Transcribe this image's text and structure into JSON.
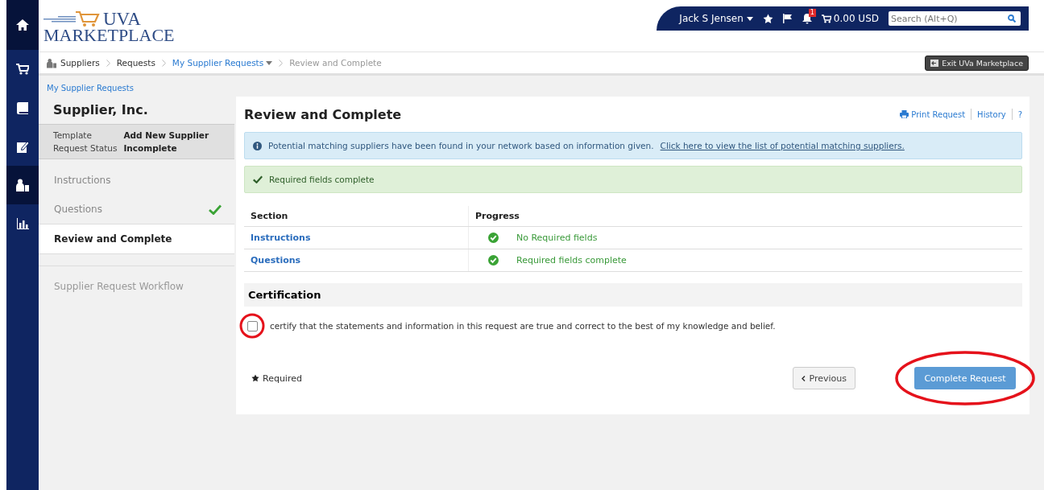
{
  "nav_icons": [
    {
      "kind": "home",
      "selected": true
    },
    {
      "kind": "cart",
      "selected": false
    },
    {
      "kind": "book",
      "selected": false
    },
    {
      "kind": "edit",
      "selected": false
    },
    {
      "kind": "suppliers",
      "selected": true
    },
    {
      "kind": "chart",
      "selected": false
    }
  ],
  "logo": {
    "line1": "UVA",
    "line2": "MARKETPLACE"
  },
  "user_bar": {
    "user": "Jack S Jensen",
    "notifications": "1",
    "cart_total": "0.00 USD",
    "search": {
      "placeholder": "Search (Alt+Q)"
    }
  },
  "breadcrumb": [
    {
      "label": "Suppliers",
      "kind": "root"
    },
    {
      "label": "Requests",
      "kind": "plain"
    },
    {
      "label": "My Supplier Requests",
      "kind": "link"
    },
    {
      "label": "Review and Complete",
      "kind": "current"
    }
  ],
  "exit_button": "Exit UVa Marketplace",
  "sidebar": {
    "back_link": "My Supplier Requests",
    "title": "Supplier, Inc.",
    "meta": [
      {
        "label": "Template",
        "value": "Add New Supplier"
      },
      {
        "label": "Request Status",
        "value": "Incomplete"
      }
    ],
    "steps": [
      {
        "label": "Instructions",
        "selected": false,
        "done": false
      },
      {
        "label": "Questions",
        "selected": false,
        "done": true
      },
      {
        "label": "Review and Complete",
        "selected": true,
        "done": false
      }
    ],
    "workflow": "Supplier Request Workflow"
  },
  "main": {
    "title": "Review and Complete",
    "actions": [
      "Print Request",
      "History",
      "?"
    ],
    "info_alert": {
      "text": "Potential matching suppliers have been found in your network based on information given.",
      "link": "Click here to view the list of potential matching suppliers."
    },
    "success_alert": "Required fields complete",
    "table": {
      "columns": [
        "Section",
        "Progress"
      ],
      "rows": [
        {
          "section": "Instructions",
          "progress": "No Required fields",
          "complete": true
        },
        {
          "section": "Questions",
          "progress": "Required fields complete",
          "complete": true
        }
      ]
    },
    "certification": {
      "heading": "Certification",
      "checked": false,
      "text": "certify that the statements and information in this request are true and correct to the best of my knowledge and belief."
    },
    "required_note": "Required",
    "buttons": [
      {
        "label": "Previous",
        "kind": "secondary"
      },
      {
        "label": "Complete Request",
        "kind": "primary"
      }
    ]
  }
}
